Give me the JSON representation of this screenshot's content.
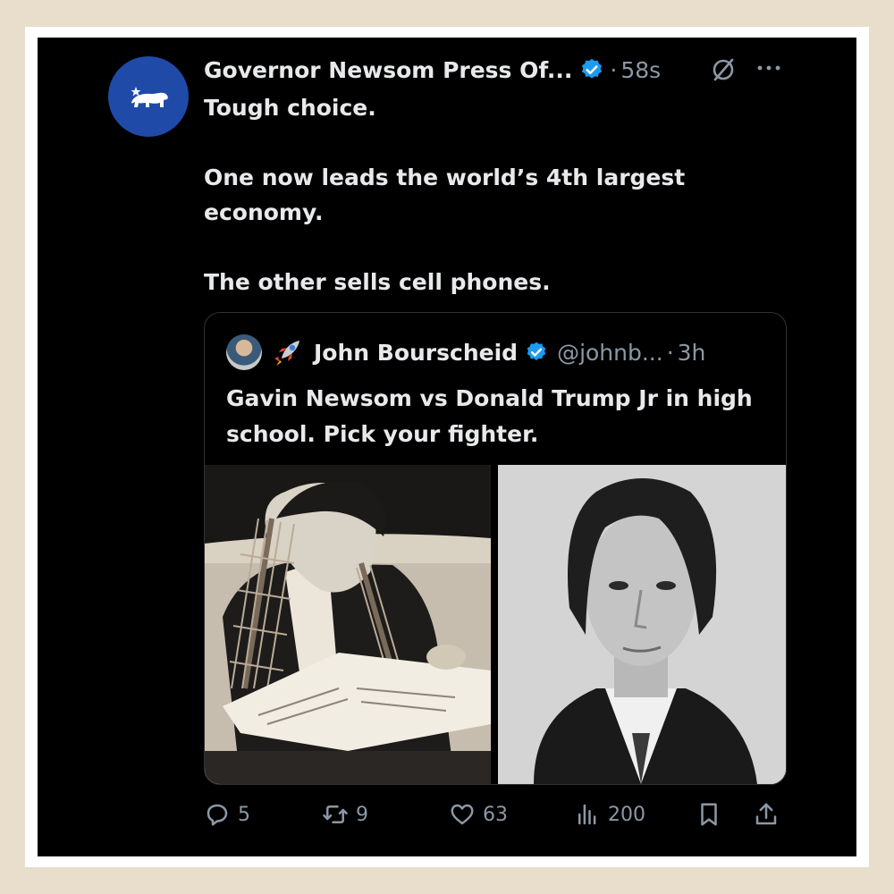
{
  "post": {
    "display_name": "Governor Newsom Press Of...",
    "separator": "·",
    "time": "58s",
    "text": [
      "Tough choice.",
      "",
      "One now leads the world’s 4th largest economy.",
      "",
      "The other sells cell phones."
    ]
  },
  "quoted_post": {
    "display_name": "John Bourscheid",
    "handle": "@johnb...",
    "separator": "·",
    "time": "3h",
    "text": "Gavin Newsom vs Donald Trump Jr in high school. Pick your fighter."
  },
  "actions": {
    "replies": "5",
    "reposts": "9",
    "likes": "63",
    "views": "200"
  },
  "colors": {
    "background": "#000000",
    "text_primary": "#e7e9ea",
    "text_secondary": "#8b98a5",
    "verified_blue": "#1d9bf0",
    "avatar_blue": "#1f4aa8",
    "outer_frame": "#e9ddcb"
  },
  "icons": [
    "verified-badge-icon",
    "grok-icon",
    "more-icon",
    "rocket-icon",
    "reply-icon",
    "retweet-icon",
    "like-icon",
    "views-icon",
    "bookmark-icon",
    "share-icon"
  ]
}
